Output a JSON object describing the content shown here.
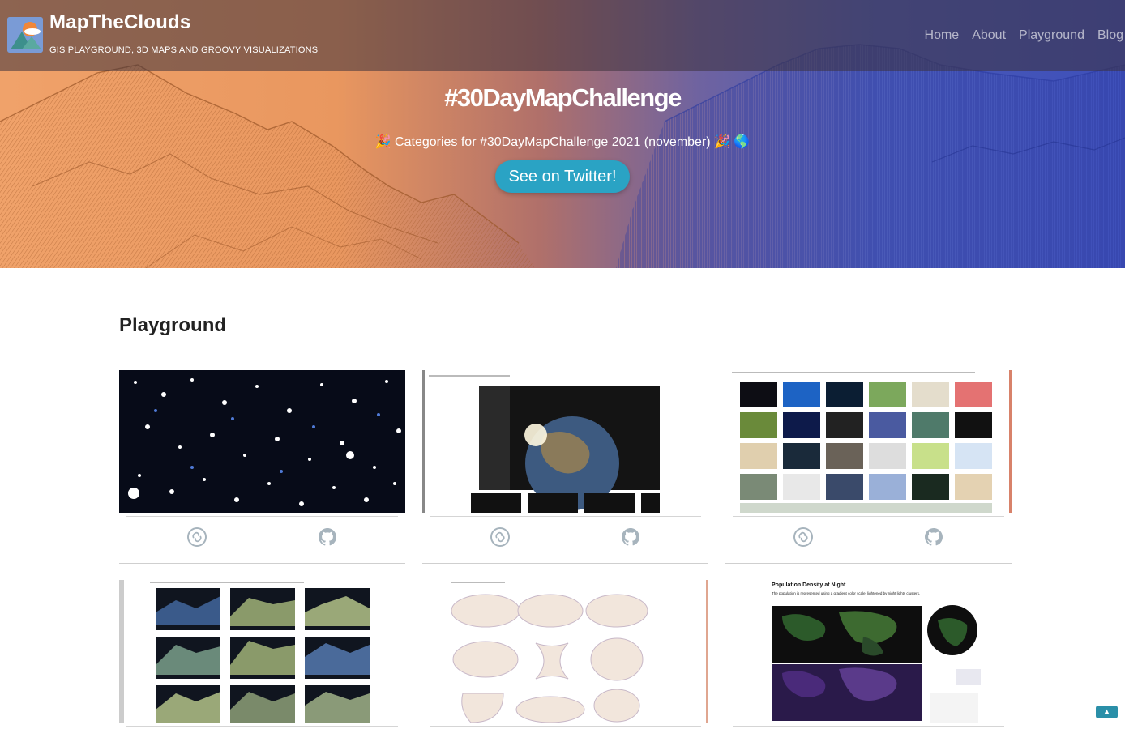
{
  "header": {
    "brand_title": "MapTheClouds",
    "brand_subtitle": "GIS PLAYGROUND, 3D MAPS AND GROOVY VISUALIZATIONS",
    "nav": [
      "Home",
      "About",
      "Playground",
      "Blog"
    ]
  },
  "hero": {
    "title": "#30DayMapChallenge",
    "subtitle": "🎉 Categories for #30DayMapChallenge 2021 (november) 🎉 🌎",
    "cta_label": "See on Twitter!"
  },
  "main": {
    "section_title": "Playground",
    "cards": [
      {
        "thumb": "starfield",
        "icons": [
          "link-icon",
          "github-icon"
        ]
      },
      {
        "thumb": "earth-render-ui",
        "icons": [
          "link-icon",
          "github-icon"
        ]
      },
      {
        "thumb": "map-grid",
        "icons": [
          "link-icon",
          "github-icon"
        ]
      },
      {
        "thumb": "terrain-grid",
        "icons": []
      },
      {
        "thumb": "projections-grid",
        "icons": []
      },
      {
        "thumb": "population-density",
        "icons": []
      }
    ],
    "pop_card": {
      "title": "Population Density at Night",
      "subtitle": "The population is represented using a gradient color scale, lightened by night lights clusters."
    }
  },
  "colors": {
    "hero_left": "#f0a26a",
    "hero_right": "#3e4fb9",
    "cta": "#2aa3c4",
    "icon": "#a7b4bd"
  }
}
